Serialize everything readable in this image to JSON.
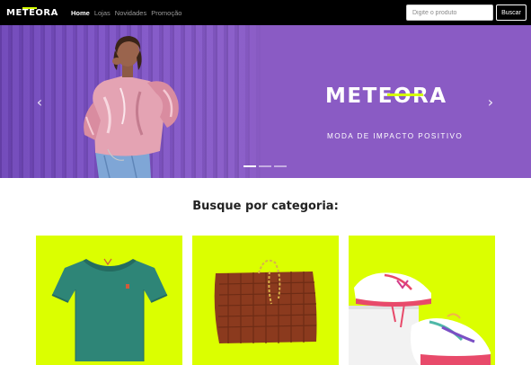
{
  "navbar": {
    "brand": "METEORA",
    "links": [
      {
        "label": "Home",
        "active": true
      },
      {
        "label": "Lojas",
        "active": false
      },
      {
        "label": "Novidades",
        "active": false
      },
      {
        "label": "Promoção",
        "active": false
      }
    ],
    "search_placeholder": "Digite o produto",
    "search_button": "Buscar"
  },
  "hero": {
    "logo": "METEORA",
    "tagline": "MODA DE IMPACTO POSITIVO",
    "prev_icon": "chevron-left-icon",
    "next_icon": "chevron-right-icon",
    "slide_count": 3,
    "active_slide": 1
  },
  "categories": {
    "title": "Busque por categoria:",
    "items": [
      {
        "icon": "tshirt-icon"
      },
      {
        "icon": "handbag-icon"
      },
      {
        "icon": "sneakers-icon"
      }
    ]
  },
  "colors": {
    "navbar_bg": "#000000",
    "accent_lime": "#dbff00",
    "hero_purple": "#8a5bc4"
  }
}
